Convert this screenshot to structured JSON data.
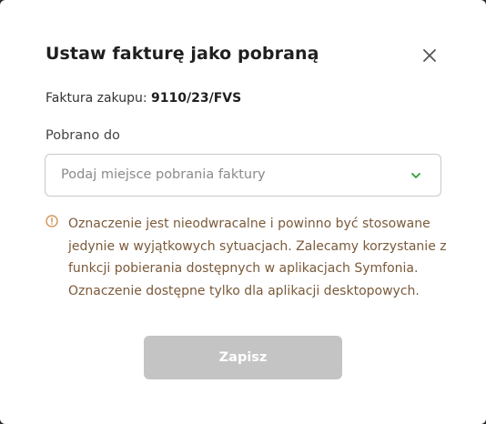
{
  "dialog": {
    "title": "Ustaw fakturę jako pobraną",
    "close_icon": "close-icon",
    "invoice_label": "Faktura zakupu: ",
    "invoice_number": "9110/23/FVS",
    "field_label": "Pobrano do",
    "select_placeholder": "Podaj miejsce pobrania faktury",
    "select_icon": "chevron-down-icon",
    "warning_icon": "info-circle-icon",
    "warning_text": "Oznaczenie jest nieodwracalne i powinno być stosowane jedynie w wyjątkowych sytuacjach. Zalecamy korzystanie z funkcji pobierania dostępnych w aplikacjach Symfonia. Oznaczenie dostępne tylko dla aplikacji desktopowych.",
    "save_label": "Zapisz",
    "save_disabled": true
  },
  "colors": {
    "chevron": "#2e9e3e",
    "warning": "#c8813c",
    "button_disabled": "#c4c4c4"
  }
}
